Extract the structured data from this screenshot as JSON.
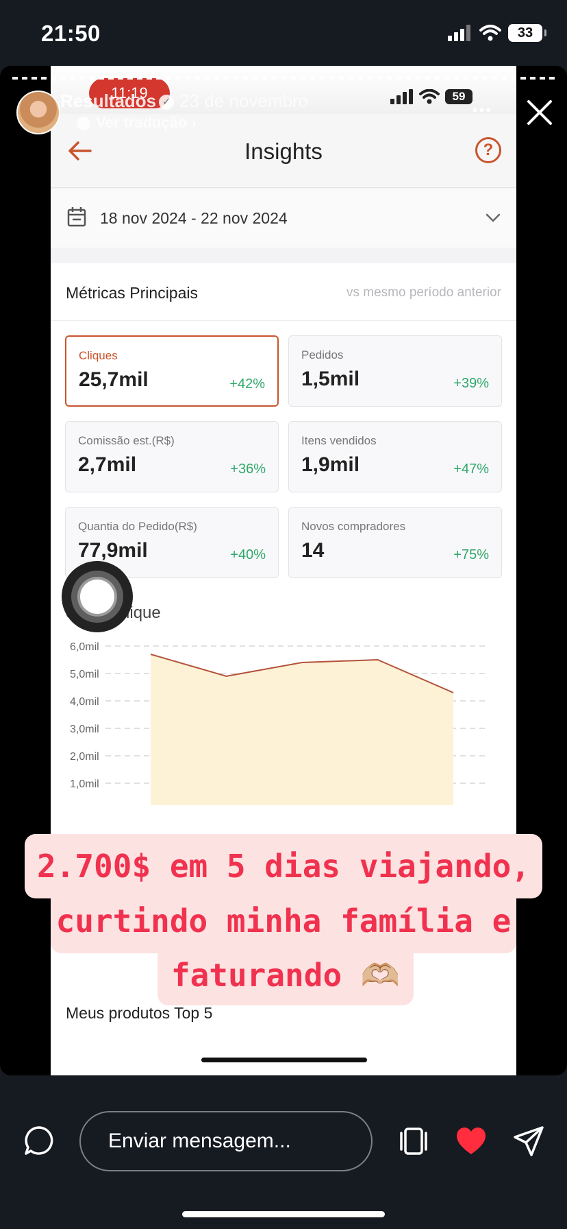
{
  "os_status": {
    "time": "21:50",
    "battery": "33"
  },
  "story": {
    "username": "Resultados",
    "date": "23 de novembro",
    "translate_label": "Ver tradução",
    "more_label": "•••"
  },
  "inner": {
    "status_time": "11:19",
    "battery": "59",
    "title": "Insights",
    "help_label": "?",
    "date_range": "18 nov 2024 - 22 nov 2024",
    "metrics_title": "Métricas Principais",
    "metrics_subtitle": "vs mesmo período anterior",
    "cards": [
      {
        "label": "Cliques",
        "value": "25,7mil",
        "delta": "+42%",
        "active": true
      },
      {
        "label": "Pedidos",
        "value": "1,5mil",
        "delta": "+39%"
      },
      {
        "label": "Comissão est.(R$)",
        "value": "2,7mil",
        "delta": "+36%"
      },
      {
        "label": "Itens vendidos",
        "value": "1,9mil",
        "delta": "+47%"
      },
      {
        "label": "Quantia do Pedido(R$)",
        "value": "77,9mil",
        "delta": "+40%"
      },
      {
        "label": "Novos compradores",
        "value": "14",
        "delta": "+75%"
      }
    ],
    "chart_title": "cia de Clique",
    "top5_title": "Meus produtos Top 5"
  },
  "chart_data": {
    "type": "area",
    "title": "cia de Clique",
    "y_ticks": [
      "6,0mil",
      "5,0mil",
      "4,0mil",
      "3,0mil",
      "2,0mil",
      "1,0mil"
    ],
    "ylim": [
      0,
      6000
    ],
    "values": [
      5700,
      4900,
      5400,
      5500,
      4300
    ],
    "grid": true,
    "line_color": "#b4523a",
    "fill_color": "#fdf2d6"
  },
  "sticker": {
    "line1": "2.700$ em 5 dias viajando,",
    "line2": "curtindo minha família e",
    "line3": "faturando 🫶🏼",
    "color": "#f0324f",
    "background": "#fde2e2"
  },
  "bottom": {
    "message_placeholder": "Enviar mensagem...",
    "reply_icon": "reply-bubble-icon",
    "heart_color": "#ff2d3d"
  }
}
